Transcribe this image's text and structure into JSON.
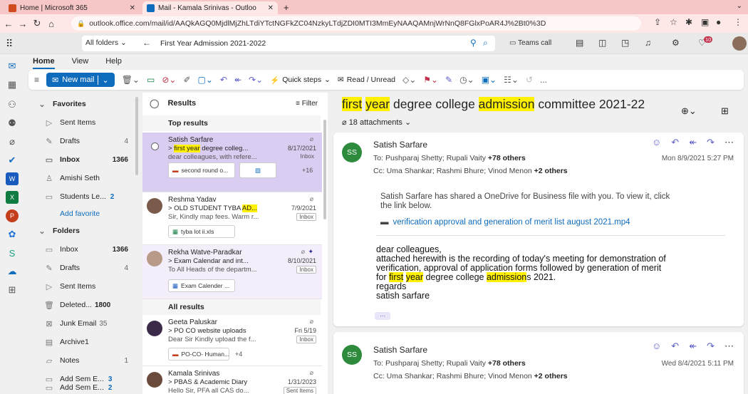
{
  "browser": {
    "tabs": [
      {
        "title": "Home | Microsoft 365"
      },
      {
        "title": "Mail - Kamala Srinivas - Outloo"
      }
    ],
    "new_tab": "+",
    "url": "outlook.office.com/mail/id/AAQkAGQ0MjdlMjZhLTdiYTctNGFkZC04NzkyLTdjZDI0MTI3MmEyNAAQAMnjWrNnQ8FGlxPoAR4J%2Bt0%3D"
  },
  "header": {
    "all_folders": "All folders",
    "search_value": "First Year Admission 2021-2022",
    "teams_call": "Teams call",
    "badge": "10"
  },
  "menu": {
    "tabs": [
      "Home",
      "View",
      "Help"
    ]
  },
  "ribbon": {
    "new_mail": "New mail",
    "quick_steps": "Quick steps",
    "read_unread": "Read / Unread",
    "more": "..."
  },
  "folders": {
    "favorites_label": "Favorites",
    "favorites": [
      {
        "name": "Sent Items",
        "count": ""
      },
      {
        "name": "Drafts",
        "count": "4"
      },
      {
        "name": "Inbox",
        "count": "1366"
      },
      {
        "name": "Amishi Seth",
        "count": ""
      },
      {
        "name": "Students Le...",
        "count": "2"
      }
    ],
    "add_favorite": "Add favorite",
    "folders_label": "Folders",
    "folders": [
      {
        "name": "Inbox",
        "count": "1366"
      },
      {
        "name": "Drafts",
        "count": "4"
      },
      {
        "name": "Sent Items",
        "count": ""
      },
      {
        "name": "Deleted...",
        "count": "1800"
      },
      {
        "name": "Junk Email",
        "count": "35"
      },
      {
        "name": "Archive1",
        "count": ""
      },
      {
        "name": "Notes",
        "count": "1"
      },
      {
        "name": "Add Sem E...",
        "count": "3"
      },
      {
        "name": "Add Sem E...",
        "count": "2"
      }
    ]
  },
  "list": {
    "results_label": "Results",
    "filter_label": "Filter",
    "top_results": "Top results",
    "all_results": "All results",
    "messages": [
      {
        "sender": "Satish Sarfare",
        "subj_pre": "> ",
        "subj_hl": "first year",
        "subj_post": " degree colleg...",
        "date": "8/17/2021",
        "preview": "dear colleagues, with refere...",
        "tag": "Inbox",
        "att1": "second round o...",
        "more": "+16"
      },
      {
        "sender": "Reshma Yadav",
        "subj_pre": "> OLD STUDENT TYBA ",
        "subj_hl": "AD...",
        "subj_post": "",
        "date": "7/9/2021",
        "preview": "Sir, Kindly map fees. Warm r...",
        "tag": "Inbox",
        "att1": "tyba lot ii.xls"
      },
      {
        "sender": "Rekha Watve-Paradkar",
        "subj_pre": "> Exam Calendar and int...",
        "subj_hl": "",
        "subj_post": "",
        "date": "8/10/2021",
        "preview": "To All Heads of the departm...",
        "tag": "Inbox",
        "att1": "Exam Calender ..."
      },
      {
        "sender": "Geeta Paluskar",
        "subj_pre": "> PO CO website uploads",
        "subj_hl": "",
        "subj_post": "",
        "date": "Fri 5/19",
        "preview": "Dear Sir Kindly upload the f...",
        "tag": "Inbox",
        "att1": "PO-CO- Human...",
        "more": "+4"
      },
      {
        "sender": "Kamala Srinivas",
        "subj_pre": "> PBAS & Academic Diary",
        "subj_hl": "",
        "subj_post": "",
        "date": "1/31/2023",
        "preview": "Hello Sir, PFA all CAS do...",
        "tag": "Sent Items"
      }
    ]
  },
  "reading": {
    "subject_hl1": "first",
    "subject_hl2": "year",
    "subject_mid": " degree college ",
    "subject_hl3": "admission",
    "subject_post": " committee 2021-22",
    "attachments": "18 attachments",
    "cards": [
      {
        "initials": "SS",
        "sender": "Satish Sarfare",
        "to_label": "To: ",
        "to": "Pushparaj Shetty;  Rupali Vaity ",
        "to_more": "+78 others",
        "cc_label": "Cc: ",
        "cc": "Uma Shankar;  Rashmi Bhure;  Vinod Menon ",
        "cc_more": "+2 others",
        "date": "Mon 8/9/2021 5:27 PM",
        "share_line1": "Satish Sarfare has shared a OneDrive for Business file with you. To view it, click",
        "share_line2": "the link below.",
        "link": "verification approval and generation of merit list august 2021.mp4",
        "body1": "dear colleagues,",
        "body2": "attached herewith is the recording of today's meeting for demonstration of",
        "body3": "verification, approval of application forms followed by generation of merit",
        "body4_pre": "for ",
        "body4_hl1": "first",
        "body4_hl2": "year",
        "body4_mid": " degree college ",
        "body4_hl3": "admission",
        "body4_post": "s 2021.",
        "body5": "regards",
        "body6": "satish sarfare",
        "dots": "..."
      },
      {
        "initials": "SS",
        "sender": "Satish Sarfare",
        "to_label": "To: ",
        "to": "Pushparaj Shetty;  Rupali Vaity ",
        "to_more": "+78 others",
        "cc_label": "Cc: ",
        "cc": "Uma Shankar;  Rashmi Bhure;  Vinod Menon ",
        "cc_more": "+2 others",
        "date": "Wed 8/4/2021 5:11 PM"
      }
    ]
  }
}
